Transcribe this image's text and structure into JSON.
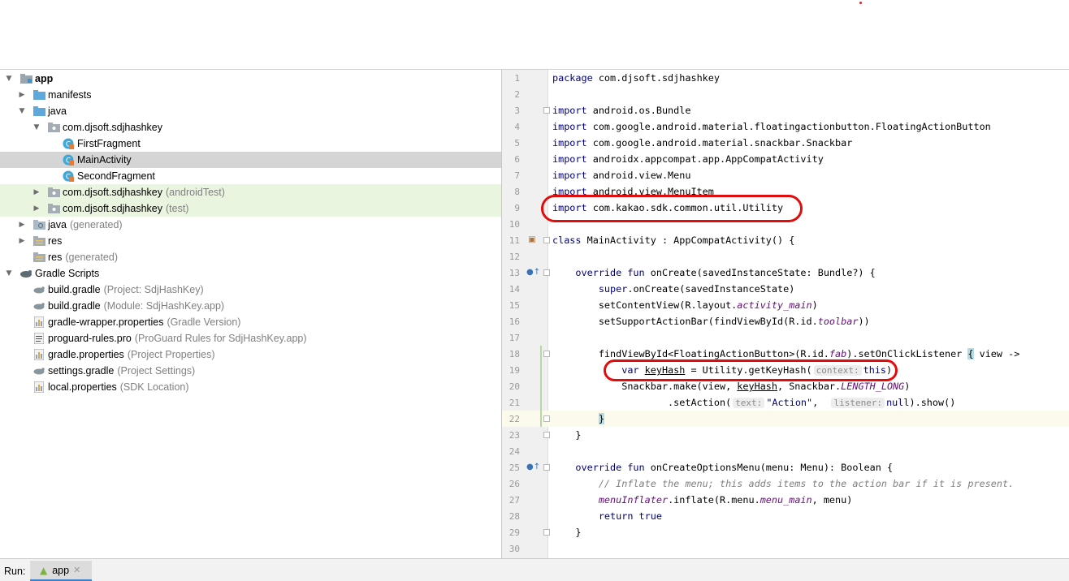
{
  "project_tree": [
    {
      "label": "app",
      "hint": "",
      "icon": "module-folder-icon",
      "arrow": "▼",
      "bold": true
    },
    {
      "label": "manifests",
      "hint": "",
      "icon": "folder-icon",
      "arrow": "▶"
    },
    {
      "label": "java",
      "hint": "",
      "icon": "folder-icon",
      "arrow": "▼"
    },
    {
      "label": "com.djsoft.sdjhashkey",
      "hint": "",
      "icon": "package-icon",
      "arrow": "▼"
    },
    {
      "label": "FirstFragment",
      "hint": "",
      "icon": "kotlin-class-icon",
      "arrow": ""
    },
    {
      "label": "MainActivity",
      "hint": "",
      "icon": "kotlin-class-icon",
      "arrow": "",
      "selected": true
    },
    {
      "label": "SecondFragment",
      "hint": "",
      "icon": "kotlin-class-icon",
      "arrow": ""
    },
    {
      "label": "com.djsoft.sdjhashkey",
      "hint": "(androidTest)",
      "icon": "package-icon",
      "arrow": "▶",
      "test": true
    },
    {
      "label": "com.djsoft.sdjhashkey",
      "hint": "(test)",
      "icon": "package-icon",
      "arrow": "▶",
      "test": true
    },
    {
      "label": "java",
      "hint": "(generated)",
      "icon": "generated-folder-icon",
      "arrow": "▶"
    },
    {
      "label": "res",
      "hint": "",
      "icon": "res-folder-icon",
      "arrow": "▶"
    },
    {
      "label": "res",
      "hint": "(generated)",
      "icon": "res-folder-icon",
      "arrow": ""
    },
    {
      "label": "Gradle Scripts",
      "hint": "",
      "icon": "gradle-icon",
      "arrow": "▼"
    },
    {
      "label": "build.gradle",
      "hint": "(Project: SdjHashKey)",
      "icon": "gradle-file-icon",
      "arrow": ""
    },
    {
      "label": "build.gradle",
      "hint": "(Module: SdjHashKey.app)",
      "icon": "gradle-file-icon",
      "arrow": ""
    },
    {
      "label": "gradle-wrapper.properties",
      "hint": "(Gradle Version)",
      "icon": "properties-file-icon",
      "arrow": ""
    },
    {
      "label": "proguard-rules.pro",
      "hint": "(ProGuard Rules for SdjHashKey.app)",
      "icon": "text-file-icon",
      "arrow": ""
    },
    {
      "label": "gradle.properties",
      "hint": "(Project Properties)",
      "icon": "properties-file-icon",
      "arrow": ""
    },
    {
      "label": "settings.gradle",
      "hint": "(Project Settings)",
      "icon": "gradle-file-icon",
      "arrow": ""
    },
    {
      "label": "local.properties",
      "hint": "(SDK Location)",
      "icon": "properties-file-icon",
      "arrow": ""
    }
  ],
  "editor": {
    "line_numbers": [
      "1",
      "2",
      "3",
      "4",
      "5",
      "6",
      "7",
      "8",
      "9",
      "10",
      "11",
      "12",
      "13",
      "14",
      "15",
      "16",
      "17",
      "18",
      "19",
      "20",
      "21",
      "22",
      "23",
      "24",
      "25",
      "26",
      "27",
      "28",
      "29",
      "30"
    ],
    "lines": [
      [
        {
          "t": "package ",
          "c": "kw"
        },
        {
          "t": "com.djsoft.sdjhashkey"
        }
      ],
      [],
      [
        {
          "t": "import ",
          "c": "kw"
        },
        {
          "t": "android.os.Bundle"
        }
      ],
      [
        {
          "t": "import ",
          "c": "kw"
        },
        {
          "t": "com.google.android.material.floatingactionbutton.FloatingActionButton"
        }
      ],
      [
        {
          "t": "import ",
          "c": "kw"
        },
        {
          "t": "com.google.android.material.snackbar.Snackbar"
        }
      ],
      [
        {
          "t": "import ",
          "c": "kw"
        },
        {
          "t": "androidx.appcompat.app.AppCompatActivity"
        }
      ],
      [
        {
          "t": "import ",
          "c": "kw"
        },
        {
          "t": "android.view.Menu"
        }
      ],
      [
        {
          "t": "import ",
          "c": "kw"
        },
        {
          "t": "android.view.MenuItem"
        }
      ],
      [
        {
          "t": "import ",
          "c": "kw"
        },
        {
          "t": "com.kakao.sdk.common.util.Utility"
        }
      ],
      [],
      [
        {
          "t": "class ",
          "c": "kw"
        },
        {
          "t": "MainActivity : AppCompatActivity() {"
        }
      ],
      [],
      [
        {
          "t": "    override fun ",
          "c": "kw"
        },
        {
          "t": "onCreate(savedInstanceState: Bundle?) {"
        }
      ],
      [
        {
          "t": "        super",
          "c": "kw"
        },
        {
          "t": ".onCreate(savedInstanceState)"
        }
      ],
      [
        {
          "t": "        setContentView(R.layout."
        },
        {
          "t": "activity_main",
          "c": "italic-purple"
        },
        {
          "t": ")"
        }
      ],
      [
        {
          "t": "        setSupportActionBar(findViewById(R.id."
        },
        {
          "t": "toolbar",
          "c": "italic-purple"
        },
        {
          "t": "))"
        }
      ],
      [],
      [
        {
          "t": "        findViewById<FloatingActionButton>(R.id."
        },
        {
          "t": "fab",
          "c": "italic-purple"
        },
        {
          "t": ").setOnClickListener "
        },
        {
          "t": "{",
          "c": "hl-brace"
        },
        {
          "t": " view ->"
        }
      ],
      [
        {
          "t": "            var ",
          "c": "kw"
        },
        {
          "t": "keyHash",
          "c": "underline"
        },
        {
          "t": " = Utility.getKeyHash("
        },
        {
          "t": "context:",
          "c": "param"
        },
        {
          "t": "this",
          "c": "kw"
        },
        {
          "t": ")"
        }
      ],
      [
        {
          "t": "            Snackbar.make(view, "
        },
        {
          "t": "keyHash",
          "c": "underline"
        },
        {
          "t": ", Snackbar."
        },
        {
          "t": "LENGTH_LONG",
          "c": "italic-purple"
        },
        {
          "t": ")"
        }
      ],
      [
        {
          "t": "                    .setAction("
        },
        {
          "t": "text:",
          "c": "param"
        },
        {
          "t": "\"Action\"",
          "c": "kw"
        },
        {
          "t": ",  "
        },
        {
          "t": "listener:",
          "c": "param"
        },
        {
          "t": "null",
          "c": "kw"
        },
        {
          "t": ").show()"
        }
      ],
      [
        {
          "t": "        "
        },
        {
          "t": "}",
          "c": "hl-brace"
        }
      ],
      [
        {
          "t": "    }"
        }
      ],
      [],
      [
        {
          "t": "    override fun ",
          "c": "kw"
        },
        {
          "t": "onCreateOptionsMenu(menu: Menu): Boolean {"
        }
      ],
      [
        {
          "t": "        // Inflate the menu; this adds items to the action bar if it is present.",
          "c": "comment"
        }
      ],
      [
        {
          "t": "        "
        },
        {
          "t": "menuInflater",
          "c": "italic-purple"
        },
        {
          "t": ".inflate(R.menu."
        },
        {
          "t": "menu_main",
          "c": "italic-purple"
        },
        {
          "t": ", menu)"
        }
      ],
      [
        {
          "t": "        return true",
          "c": "kw"
        }
      ],
      [
        {
          "t": "    }"
        }
      ],
      []
    ]
  },
  "bottom_bar": {
    "run_label": "Run:",
    "run_tab_label": "app",
    "close_glyph": "✕"
  }
}
